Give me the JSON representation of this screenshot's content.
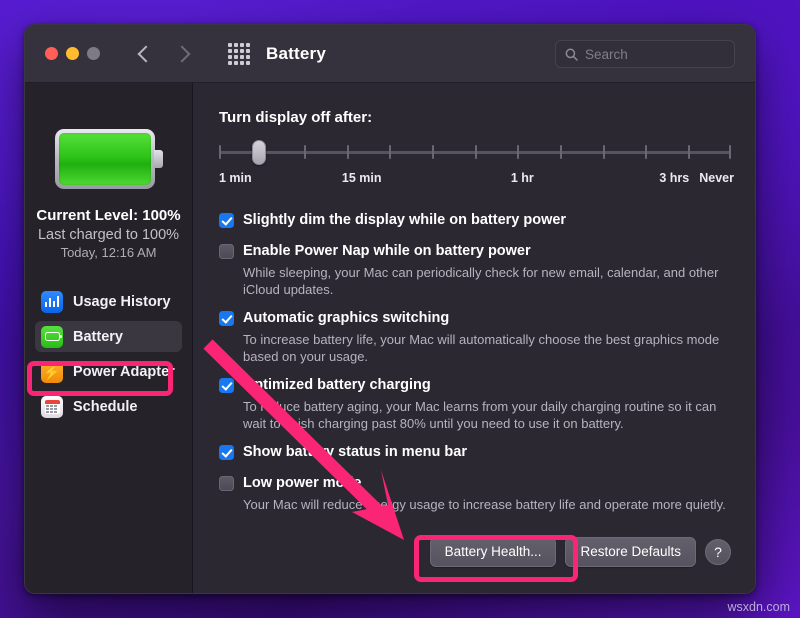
{
  "window": {
    "title": "Battery",
    "traffic_lights": [
      "close",
      "minimize",
      "zoom"
    ],
    "back_icon": "chevron-left-icon",
    "forward_icon": "chevron-right-icon",
    "grid_icon": "grid-apps-icon",
    "search": {
      "placeholder": "Search",
      "value": "",
      "icon": "search-icon"
    }
  },
  "sidebar": {
    "battery_graphic": "battery-full-icon",
    "current_level": "Current Level: 100%",
    "last_charged": "Last charged to 100%",
    "last_charged_time": "Today, 12:16 AM",
    "items": [
      {
        "label": "Usage History",
        "icon": "usage-history-icon",
        "selected": false
      },
      {
        "label": "Battery",
        "icon": "battery-icon",
        "selected": true
      },
      {
        "label": "Power Adapter",
        "icon": "power-adapter-icon",
        "selected": false
      },
      {
        "label": "Schedule",
        "icon": "schedule-icon",
        "selected": false
      }
    ]
  },
  "main": {
    "slider": {
      "title": "Turn display off after:",
      "value_label": "1 min",
      "value_position_pct": 8,
      "tick_count": 13,
      "labels": [
        {
          "text": "1 min",
          "pos_pct": 0
        },
        {
          "text": "15 min",
          "pos_pct": 25
        },
        {
          "text": "1 hr",
          "pos_pct": 58
        },
        {
          "text": "3 hrs",
          "pos_pct": 88
        },
        {
          "text": "Never",
          "pos_pct": 100
        }
      ]
    },
    "options": [
      {
        "label": "Slightly dim the display while on battery power",
        "checked": true,
        "description": ""
      },
      {
        "label": "Enable Power Nap while on battery power",
        "checked": false,
        "description": "While sleeping, your Mac can periodically check for new email, calendar, and other iCloud updates."
      },
      {
        "label": "Automatic graphics switching",
        "checked": true,
        "description": "To increase battery life, your Mac will automatically choose the best graphics mode based on your usage."
      },
      {
        "label": "Optimized battery charging",
        "checked": true,
        "description": "To reduce battery aging, your Mac learns from your daily charging routine so it can wait to finish charging past 80% until you need to use it on battery."
      },
      {
        "label": "Show battery status in menu bar",
        "checked": true,
        "description": ""
      },
      {
        "label": "Low power mode",
        "checked": false,
        "description": "Your Mac will reduce energy usage to increase battery life and operate more quietly."
      }
    ],
    "footer": {
      "battery_health": "Battery Health...",
      "restore_defaults": "Restore Defaults",
      "help": "?"
    }
  },
  "annotations": {
    "highlight_color": "#fb2576",
    "arrow_color": "#fb2576",
    "sidebar_highlight_target": "Battery",
    "button_highlight_target": "Battery Health..."
  },
  "watermark": "wsxdn.com"
}
